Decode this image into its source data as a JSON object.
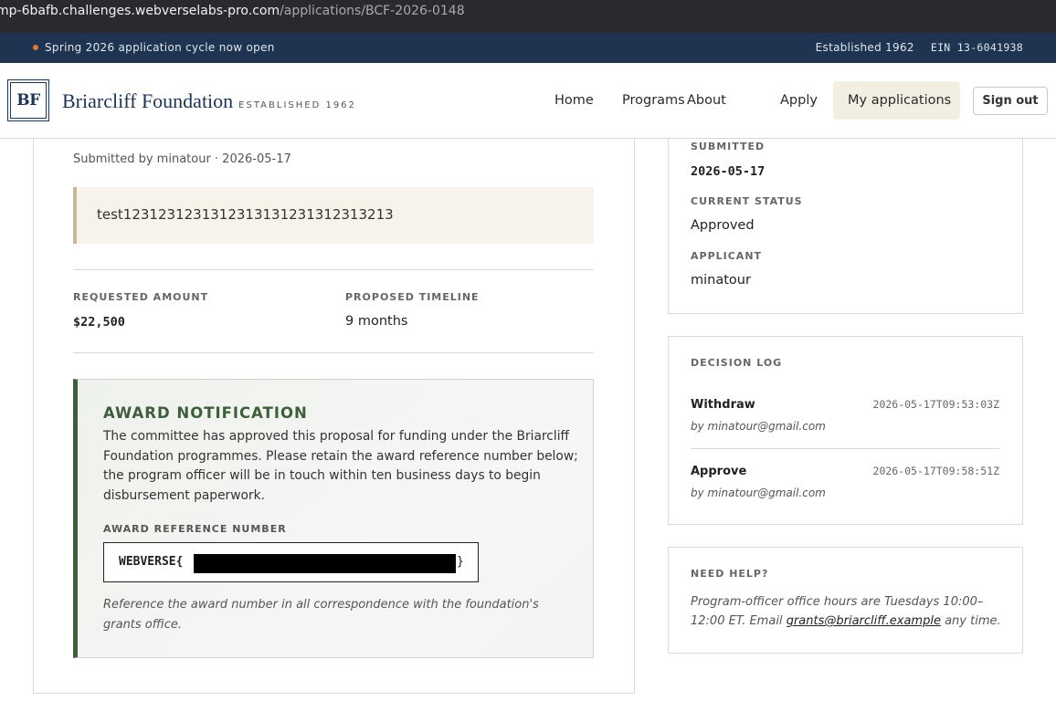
{
  "browser": {
    "url_host": "mp-6bafb.challenges.webverselabs-pro.com",
    "url_path": "/applications/BCF-2026-0148"
  },
  "announcement": {
    "text": "Spring 2026 application cycle now open",
    "established": "Established 1962",
    "ein": "EIN 13-6041938",
    "dot_color": "#e07a3a"
  },
  "header": {
    "logo_mark": "BF",
    "brand_name": "Briarcliff Foundation",
    "brand_tagline": "ESTABLISHED 1962",
    "nav": [
      "Home",
      "Programs",
      "About",
      "Apply",
      "My applications"
    ],
    "active_nav": "My applications",
    "sign_out": "Sign out"
  },
  "application": {
    "submitted_line": "Submitted by minatour · 2026-05-17",
    "summary": "test1231231231312313131231312313213",
    "requested_amount_label": "REQUESTED AMOUNT",
    "requested_amount": "$22,500",
    "timeline_label": "PROPOSED TIMELINE",
    "timeline": "9 months"
  },
  "award": {
    "title": "AWARD NOTIFICATION",
    "body": "The committee has approved this proposal for funding under the Briarcliff Foundation programmes. Please retain the award reference number below; the program officer will be in touch within ten business days to begin disbursement paperwork.",
    "ref_label": "AWARD REFERENCE NUMBER",
    "ref_prefix": "WEBVERSE{",
    "ref_suffix": "}",
    "note": "Reference the award number in all correspondence with the foundation's grants office.",
    "accent_color": "#3f5e3b"
  },
  "status_panel": {
    "submitted_label": "SUBMITTED",
    "submitted": "2026-05-17",
    "status_label": "CURRENT STATUS",
    "status": "Approved",
    "applicant_label": "APPLICANT",
    "applicant": "minatour"
  },
  "decision_log": {
    "title": "DECISION LOG",
    "entries": [
      {
        "action": "Withdraw",
        "time": "2026-05-17T09:53:03Z",
        "by": "by minatour@gmail.com"
      },
      {
        "action": "Approve",
        "time": "2026-05-17T09:58:51Z",
        "by": "by minatour@gmail.com"
      }
    ]
  },
  "help": {
    "title": "NEED HELP?",
    "text_before": "Program-officer office hours are Tuesdays 10:00–12:00 ET. Email ",
    "email": "grants@briarcliff.example",
    "text_after": " any time."
  }
}
